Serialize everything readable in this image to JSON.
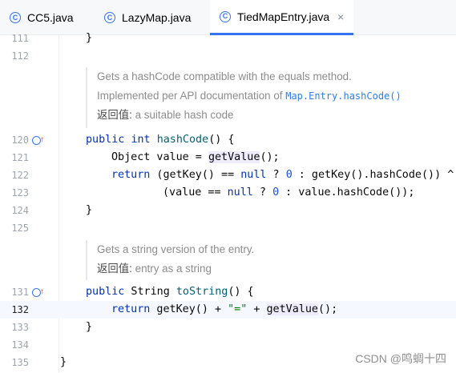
{
  "tabs": [
    {
      "label": "CC5.java",
      "icon": "class-file-icon",
      "active": false
    },
    {
      "label": "LazyMap.java",
      "icon": "class-file-icon",
      "active": false
    },
    {
      "label": "TiedMapEntry.java",
      "icon": "class-file-icon",
      "active": true,
      "close": "×"
    }
  ],
  "editor": {
    "lines": {
      "l111": {
        "num": "111",
        "code": "}"
      },
      "l112": {
        "num": "112"
      },
      "l120": {
        "num": "120"
      },
      "l121": {
        "num": "121"
      },
      "l122": {
        "num": "122"
      },
      "l123": {
        "num": "123"
      },
      "l124": {
        "num": "124",
        "code": "}"
      },
      "l125": {
        "num": "125"
      },
      "l131": {
        "num": "131"
      },
      "l132": {
        "num": "132"
      },
      "l133": {
        "num": "133",
        "code": "}"
      },
      "l134": {
        "num": "134"
      },
      "l135": {
        "num": "135",
        "code": "}"
      }
    },
    "tokens": {
      "public": "public",
      "int": "int",
      "hashCode": "hashCode",
      "openSig": "() {",
      "objectValue": "Object value = ",
      "getValue": "getValue",
      "semiParen": "();",
      "return": "return",
      "paren1": " (getKey() == ",
      "null": "null",
      "tern1": " ? ",
      "zero": "0",
      "rest1": " : getKey().hashCode()) ^",
      "paren2": "(value == ",
      "rest2": " : value.hashCode());",
      "string": " String ",
      "toString": "toString",
      "ret2a": " getKey() + ",
      "eqStr": "\"=\"",
      "plus": " + ",
      "semi2": "();"
    },
    "doc1": {
      "line1": "Gets a hashCode compatible with the equals method.",
      "line2_text": "Implemented per API documentation of ",
      "line2_link": "Map.Entry.hashCode()",
      "ret_label": "返回值:",
      "ret_text": " a suitable hash code"
    },
    "doc2": {
      "line1": "Gets a string version of the entry.",
      "ret_label": "返回值:",
      "ret_text": " entry as a string"
    }
  },
  "watermark": "CSDN @鸣蜩十四",
  "colors": {
    "accent": "#3574f0",
    "keyword": "#0033b3",
    "method": "#00627a",
    "number": "#1750eb",
    "string": "#067d17"
  }
}
